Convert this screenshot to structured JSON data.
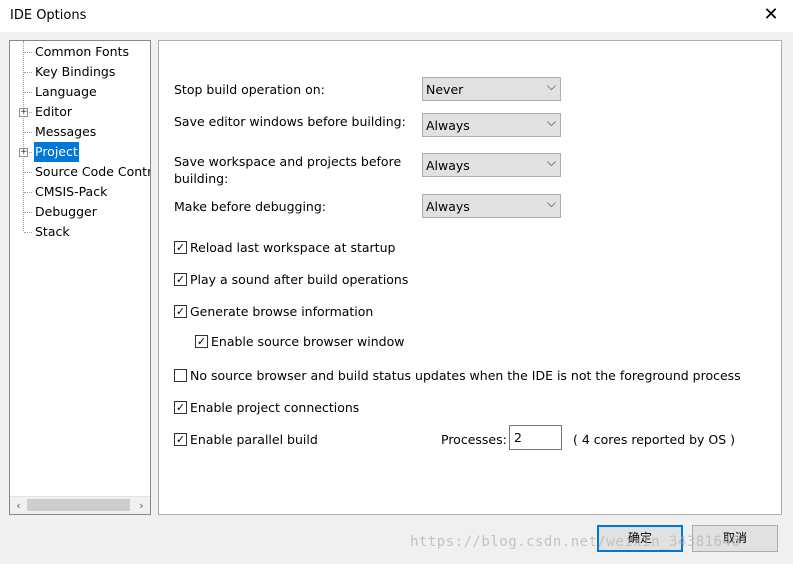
{
  "window": {
    "title": "IDE Options"
  },
  "tree": {
    "items": [
      {
        "label": "Common Fonts",
        "expandable": false,
        "selected": false
      },
      {
        "label": "Key Bindings",
        "expandable": false,
        "selected": false
      },
      {
        "label": "Language",
        "expandable": false,
        "selected": false
      },
      {
        "label": "Editor",
        "expandable": true,
        "selected": false
      },
      {
        "label": "Messages",
        "expandable": false,
        "selected": false
      },
      {
        "label": "Project",
        "expandable": true,
        "selected": true
      },
      {
        "label": "Source Code Contro",
        "expandable": false,
        "selected": false
      },
      {
        "label": "CMSIS-Pack",
        "expandable": false,
        "selected": false
      },
      {
        "label": "Debugger",
        "expandable": false,
        "selected": false
      },
      {
        "label": "Stack",
        "expandable": false,
        "selected": false
      }
    ],
    "expand_glyph": "+"
  },
  "settings": {
    "stop_build": {
      "label": "Stop build operation on:",
      "value": "Never"
    },
    "save_editor": {
      "label": "Save editor windows before building:",
      "value": "Always"
    },
    "save_workspace": {
      "label_line1": "Save workspace and projects before",
      "label_line2": "building:",
      "value": "Always"
    },
    "make_before_debug": {
      "label": "Make before debugging:",
      "value": "Always"
    }
  },
  "checkboxes": {
    "reload_workspace": {
      "label": "Reload last workspace at startup",
      "checked": true
    },
    "play_sound": {
      "label": "Play a sound after build operations",
      "checked": true
    },
    "generate_browse": {
      "label": "Generate browse information",
      "checked": true
    },
    "enable_source_browser": {
      "label": "Enable source browser window",
      "checked": true
    },
    "no_source_browser": {
      "label": "No source browser and build status updates when the IDE is not the foreground process",
      "checked": false
    },
    "enable_project_connections": {
      "label": "Enable project connections",
      "checked": true
    },
    "enable_parallel_build": {
      "label": "Enable parallel build",
      "checked": true
    }
  },
  "processes": {
    "label": "Processes:",
    "value": "2",
    "cores_note": "( 4 cores reported by OS )"
  },
  "buttons": {
    "ok": "确定",
    "cancel": "取消"
  },
  "glyphs": {
    "check": "✓",
    "chevron": "⌵",
    "close": "✕",
    "left": "‹",
    "right": "›"
  },
  "watermark": "https://blog.csdn.net/weixin_34381646"
}
